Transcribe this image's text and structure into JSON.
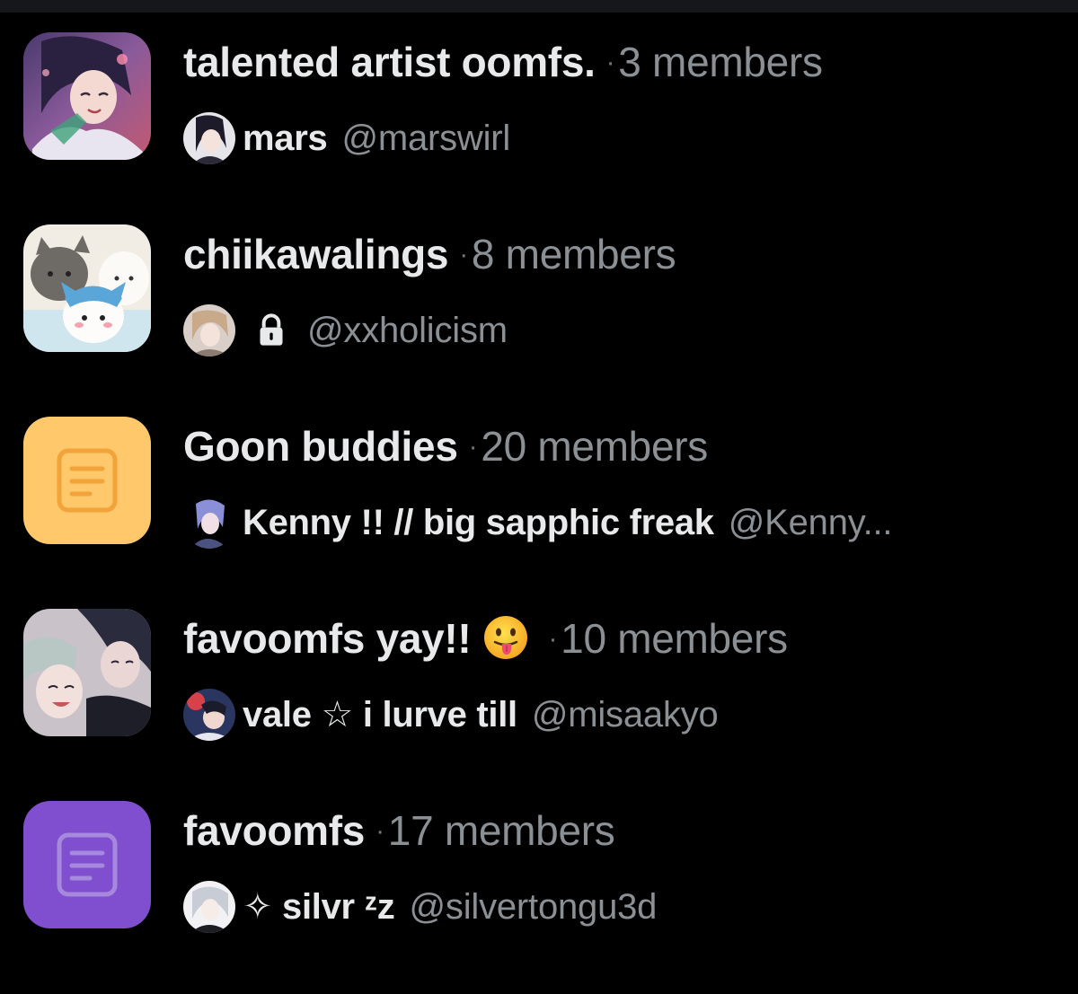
{
  "lists": [
    {
      "name": "talented artist oomfs.",
      "members": "3 members",
      "owner_name": "mars",
      "owner_handle": "@marswirl",
      "thumb_kind": "photo",
      "thumb_icon": "anime-art-thumbnail"
    },
    {
      "name": "chiikawalings",
      "members": "8 members",
      "owner_name": "",
      "owner_handle": "@xxholicism",
      "owner_protected": true,
      "thumb_kind": "photo",
      "thumb_icon": "plush-toys-thumbnail"
    },
    {
      "name": "Goon buddies",
      "members": "20 members",
      "owner_name": "Kenny !! // big sapphic freak",
      "owner_handle": "@Kenny...",
      "thumb_kind": "placeholder",
      "thumb_color": "#ffc96b",
      "thumb_icon": "document-icon"
    },
    {
      "name": "favoomfs yay!!",
      "emoji": "tongue-out-face-emoji",
      "members": "10 members",
      "owner_name": "vale ☆ i lurve till",
      "owner_handle": "@misaakyo",
      "thumb_kind": "photo",
      "thumb_icon": "anime-characters-thumbnail"
    },
    {
      "name": "favoomfs",
      "members": "17 members",
      "owner_name": "✧ silvr ᶻz",
      "owner_handle": "@silvertongu3d",
      "thumb_kind": "placeholder",
      "thumb_color": "#7f4fcf",
      "thumb_icon": "document-icon"
    }
  ],
  "separator": "·",
  "colors": {
    "background": "#000000",
    "primary_text": "#e7e9ea",
    "secondary_text": "#8b9095",
    "yellow_thumb": "#ffc96b",
    "purple_thumb": "#7f4fcf"
  }
}
